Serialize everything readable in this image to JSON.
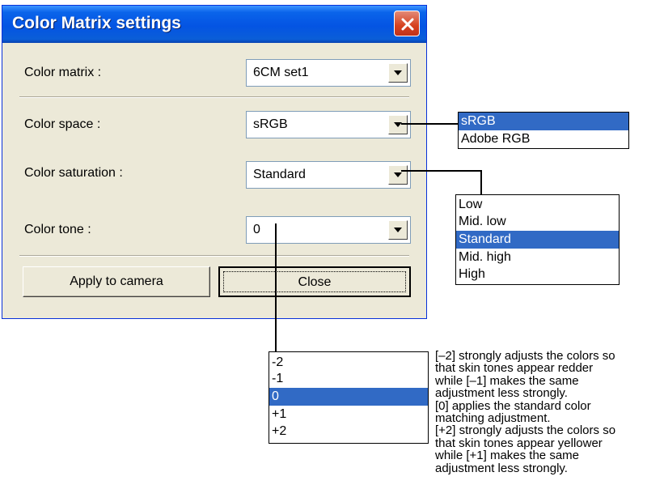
{
  "dialog": {
    "title": "Color Matrix settings",
    "close_icon": "close-x-icon",
    "fields": {
      "color_matrix": {
        "label": "Color matrix :",
        "value": "6CM set1"
      },
      "color_space": {
        "label": "Color space :",
        "value": "sRGB"
      },
      "color_saturation": {
        "label": "Color saturation :",
        "value": "Standard"
      },
      "color_tone": {
        "label": "Color tone :",
        "value": "0"
      }
    },
    "buttons": {
      "apply": "Apply to camera",
      "close": "Close"
    }
  },
  "dropdowns": {
    "color_space_options": [
      "sRGB",
      "Adobe RGB"
    ],
    "color_space_selected": "sRGB",
    "saturation_options": [
      "Low",
      "Mid. low",
      "Standard",
      "Mid. high",
      "High"
    ],
    "saturation_selected": "Standard",
    "tone_options": [
      "-2",
      "-1",
      "0",
      "+1",
      "+2"
    ],
    "tone_selected": "0"
  },
  "description": {
    "lines": [
      "[–2] strongly adjusts the colors so",
      "that skin tones appear redder",
      "while [–1] makes the same",
      "adjustment less strongly.",
      "[0] applies the standard color",
      "matching adjustment.",
      "[+2] strongly adjusts the colors so",
      "that skin tones appear yellower",
      "while [+1] makes the same",
      "adjustment less strongly."
    ]
  },
  "colors": {
    "title_bar": "#0454e3",
    "selection": "#316ac5",
    "close_button": "#d6411f",
    "dialog_face": "#ece9d8"
  }
}
